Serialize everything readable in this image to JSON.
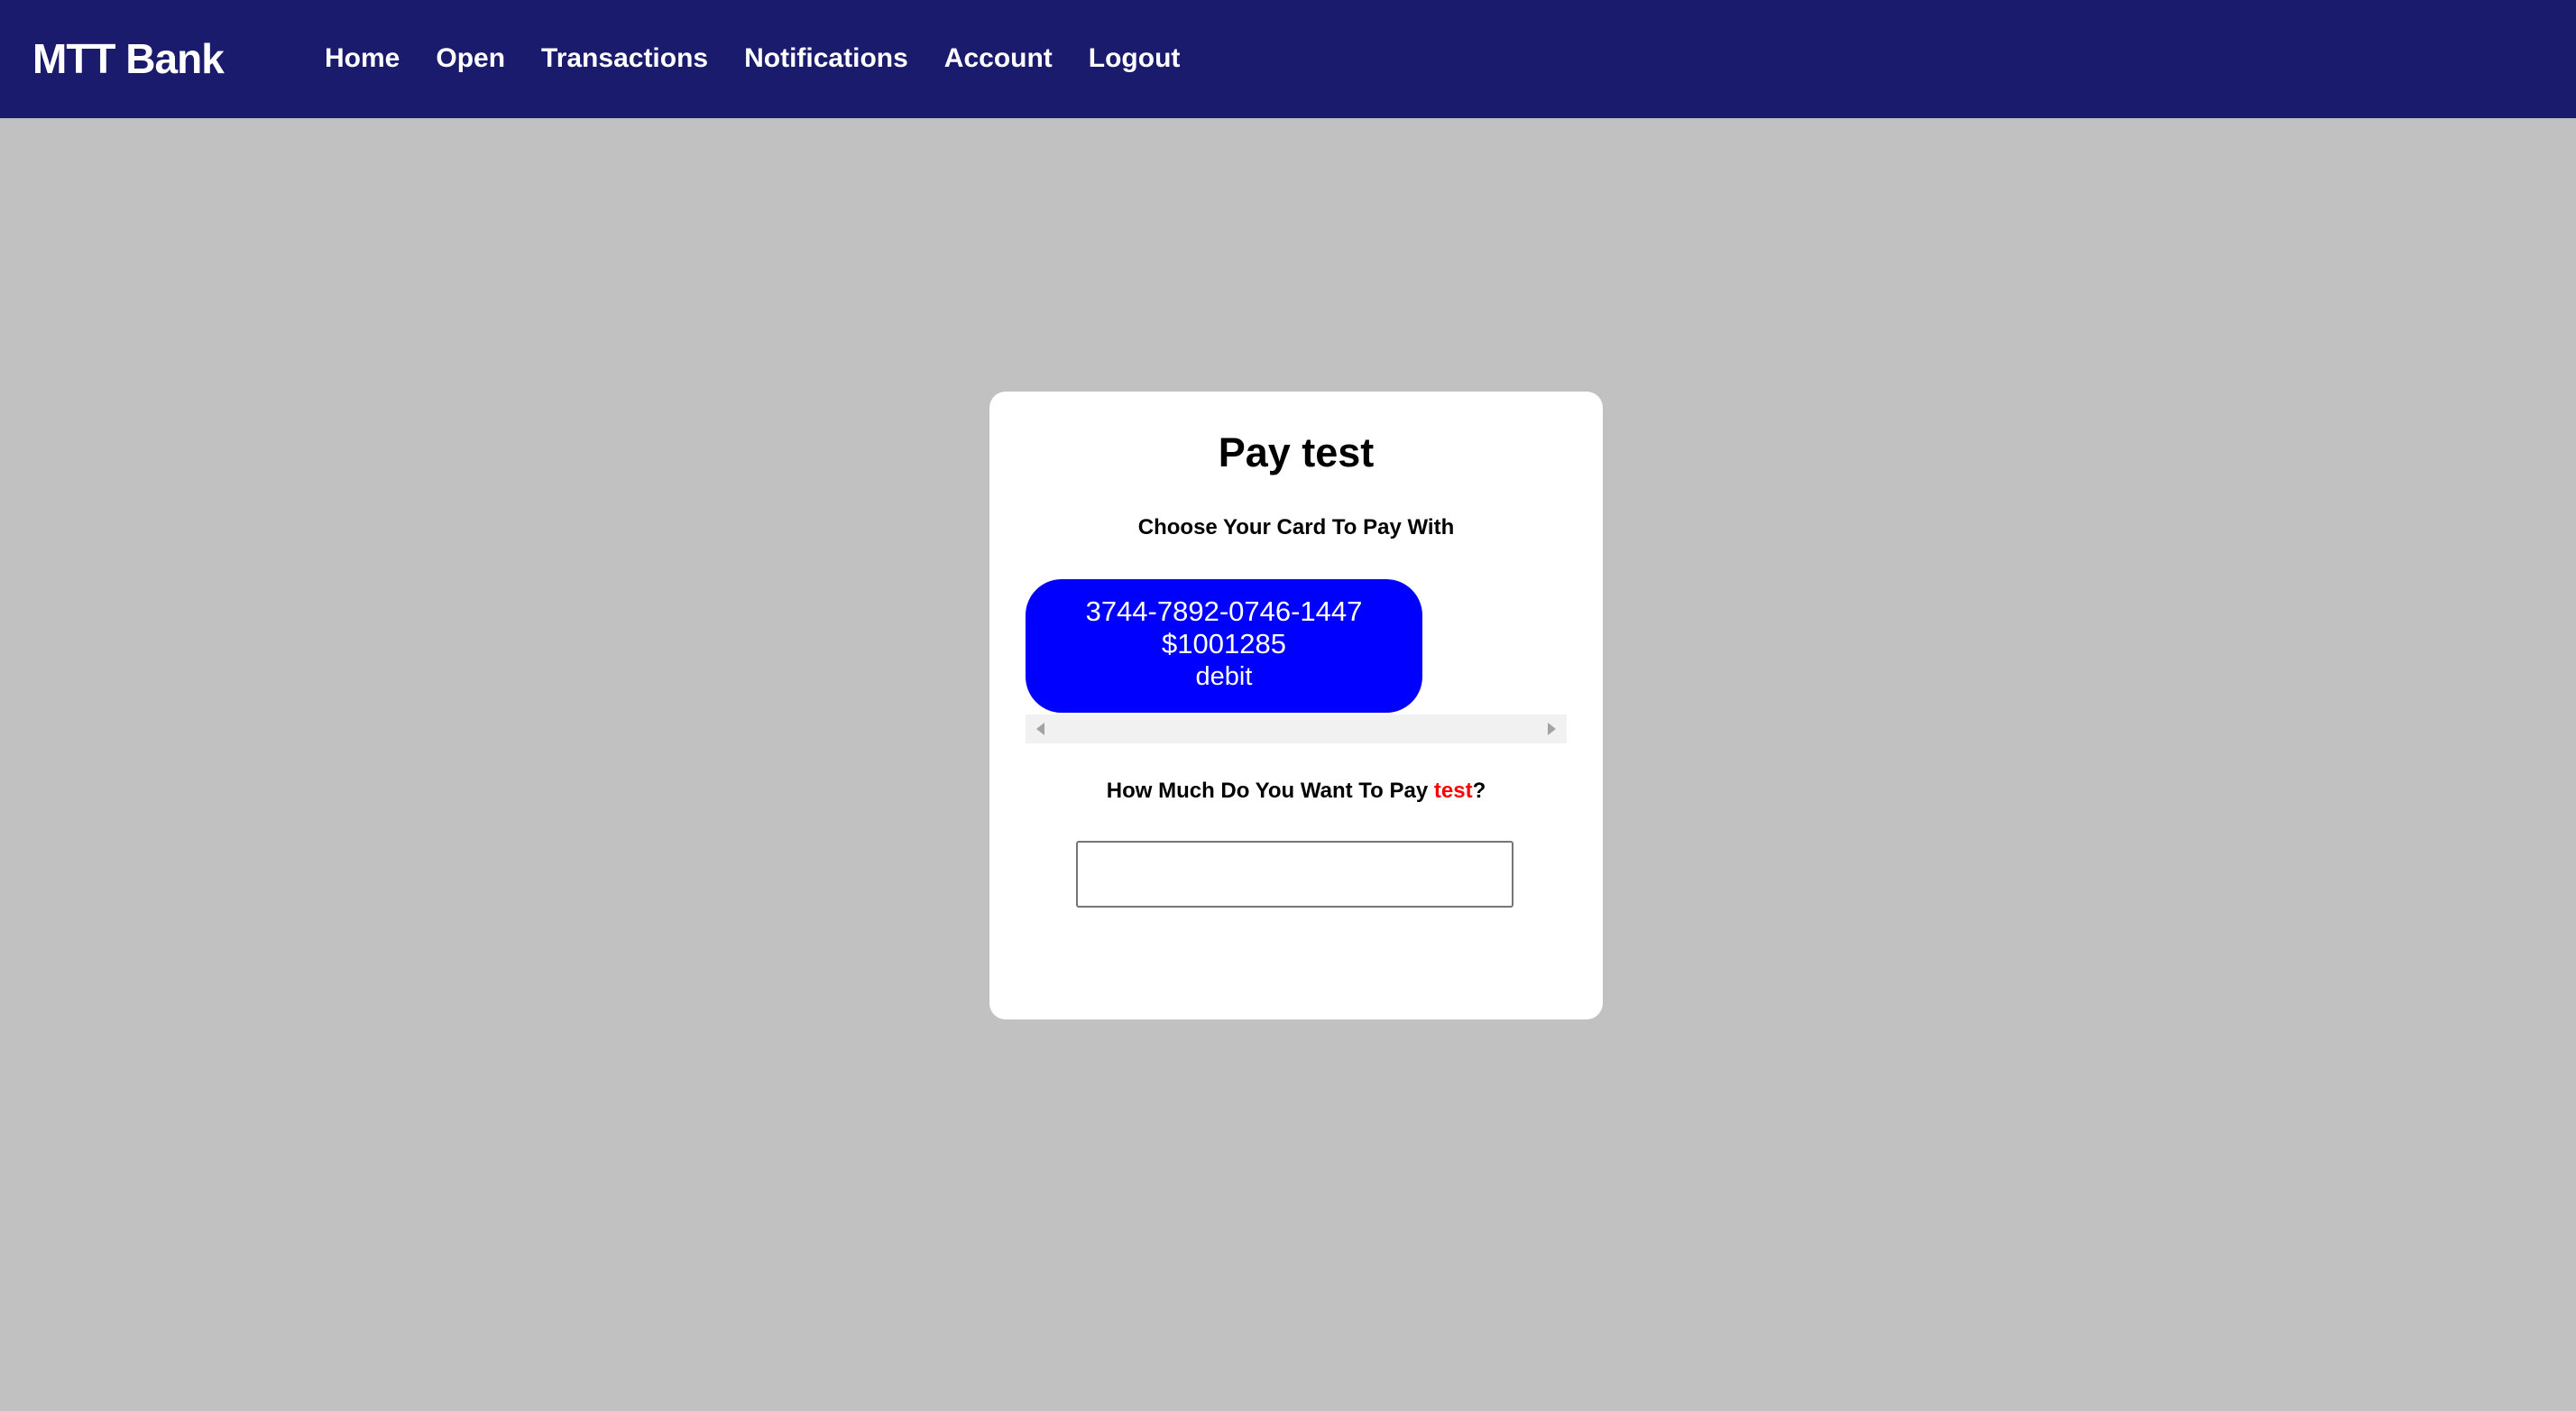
{
  "header": {
    "brand": "MTT Bank",
    "nav": [
      "Home",
      "Open",
      "Transactions",
      "Notifications",
      "Account",
      "Logout"
    ]
  },
  "payment": {
    "title": "Pay test",
    "subtitle": "Choose Your Card To Pay With",
    "card": {
      "number": "3744-7892-0746-1447",
      "balance": "$1001285",
      "type": "debit",
      "color": "#0000ff"
    },
    "question_prefix": "How Much Do You Want To Pay ",
    "payee": "test",
    "question_suffix": "?",
    "amount_value": ""
  },
  "colors": {
    "header_bg": "#1b1b6e",
    "page_bg": "#c1c1c1",
    "payee_text": "#ff0000"
  }
}
